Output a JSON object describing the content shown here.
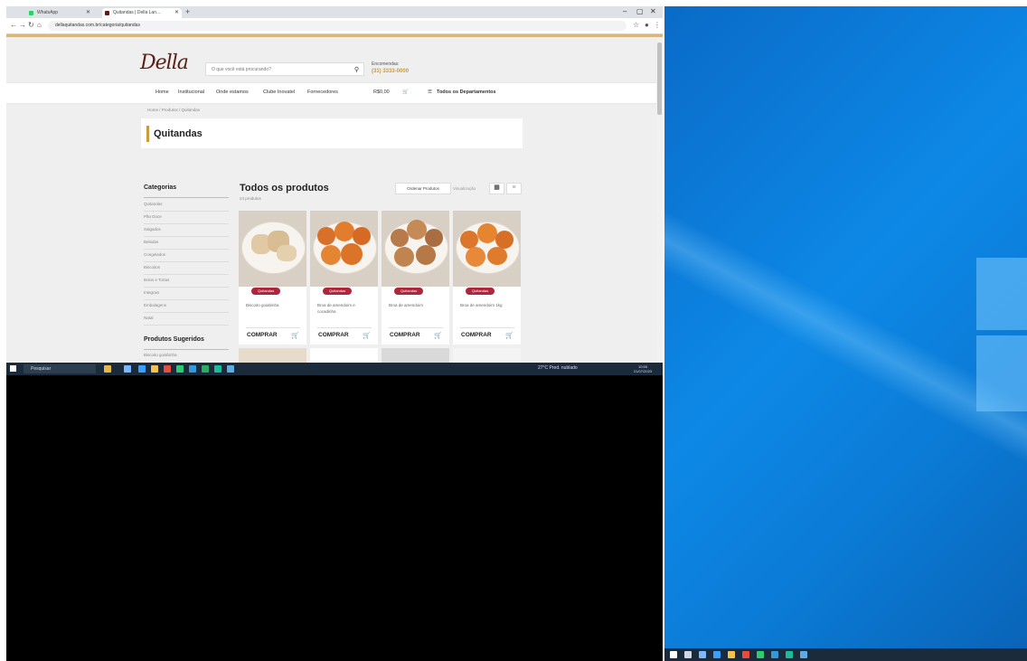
{
  "browser": {
    "tabs": [
      {
        "label": "WhatsApp",
        "active": false
      },
      {
        "label": "Quitandas | Della Lan...",
        "active": true
      }
    ],
    "new_tab": "+",
    "window_controls": {
      "minimize": "–",
      "maximize": "▢",
      "close": "✕"
    },
    "url": "dellaquitandas.com.br/categoria/quitandas",
    "nav": {
      "back": "←",
      "forward": "→",
      "reload": "↻",
      "home": "⌂"
    }
  },
  "site": {
    "logo": "Della",
    "search_placeholder": "O que você está procurando?",
    "contact_label": "Encomendas:",
    "contact_phone": "(31) 3333-0000",
    "nav_items": [
      "Home",
      "Institucional",
      "Onde estamos",
      "Clube Inovatel",
      "Fornecedores"
    ],
    "currency": "R$0,00",
    "departments_label": "Todos os Departamentos",
    "breadcrumb": "Home / Produtos / Quitandas",
    "page_title": "Quitandas"
  },
  "sidebar": {
    "categories_title": "Categorias",
    "categories": [
      "Quitandas",
      "Pão Doce",
      "Salgados",
      "Bebidas",
      "Congelados",
      "Biscoitos",
      "Bolos e Tortas",
      "Integrais",
      "Embalagens",
      "Natal"
    ],
    "suggested_title": "Produtos Sugeridos",
    "suggested_first": "Biscoito goiabinha"
  },
  "products_section": {
    "title": "Todos os produtos",
    "count": "24 produtos",
    "sort_label": "Ordenar Produtos",
    "sort_caption": "Visualização",
    "view_grid_icon": "grid-icon",
    "view_list_icon": "list-icon",
    "cards": [
      {
        "name": "Biscoito goiabinha",
        "badge": "Quitandas",
        "button": "COMPRAR"
      },
      {
        "name": "Broa de amendoim e cocadinha",
        "badge": "Quitandas",
        "button": "COMPRAR"
      },
      {
        "name": "Broa de amendoim",
        "badge": "Quitandas",
        "button": "COMPRAR"
      },
      {
        "name": "Broa de amendoim 1kg",
        "badge": "Quitandas",
        "button": "COMPRAR"
      }
    ]
  },
  "taskbar": {
    "search_placeholder": "Pesquisar",
    "tray_text": "27°C  Pred. nublado",
    "clock_time": "10:55",
    "clock_date": "21/07/2023"
  },
  "colors": {
    "accent_gold": "#c99b3b",
    "badge_red": "#b0253c",
    "brand_brown": "#5a1e12",
    "desktop_blue": "#0d88e6",
    "taskbar": "#1b2b3c"
  }
}
